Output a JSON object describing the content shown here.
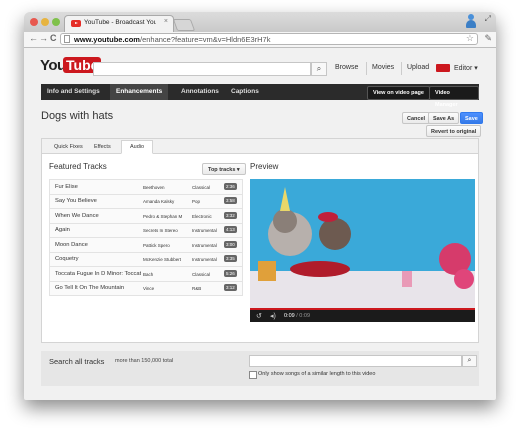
{
  "browser": {
    "tab_title": "YouTube - Broadcast Yoursel",
    "tab_close": "×",
    "url_host": "www.youtube.com",
    "url_path": "/enhance?feature=vm&v=Hldn6E3rH7k",
    "back": "←",
    "forward": "→",
    "reload": "C"
  },
  "youtube": {
    "logo_you": "You",
    "logo_tube": "Tube",
    "header_links": [
      "Browse",
      "Movies",
      "Upload"
    ],
    "user": "Editor ▾"
  },
  "nav": {
    "items": [
      "Info and Settings",
      "Enhancements",
      "Annotations",
      "Captions"
    ],
    "active_index": 1,
    "right_buttons": [
      "View on video page",
      "Video Manager"
    ]
  },
  "video_title": "Dogs with hats",
  "actions": {
    "cancel": "Cancel",
    "save_as": "Save As",
    "save": "Save",
    "revert": "Revert to original"
  },
  "subtabs": [
    "Quick Fixes",
    "Effects",
    "Audio"
  ],
  "active_subtab": 2,
  "featured": {
    "title": "Featured Tracks",
    "sort_label": "Top tracks ▾",
    "tracks": [
      {
        "title": "Fur Elise",
        "artist": "Beethoven",
        "genre": "Classical",
        "duration": "2:36"
      },
      {
        "title": "Say You Believe",
        "artist": "Amanda Kalsky",
        "genre": "Pop",
        "duration": "3:58"
      },
      {
        "title": "When We Dance",
        "artist": "Pedro & Stephan M",
        "genre": "Electronic",
        "duration": "3:32"
      },
      {
        "title": "Again",
        "artist": "Secrets In Stereo",
        "genre": "Instrumental",
        "duration": "4:13"
      },
      {
        "title": "Moon Dance",
        "artist": "Pattick Spero",
        "genre": "Instrumental",
        "duration": "3:00"
      },
      {
        "title": "Coquetry",
        "artist": "McKenzie Stubbert",
        "genre": "Instrumental",
        "duration": "3:35"
      },
      {
        "title": "Toccata Fugue In D Minor: Toccata",
        "artist": "Bach",
        "genre": "Classical",
        "duration": "5:26"
      },
      {
        "title": "Go Tell It On The Mountain",
        "artist": "Vince",
        "genre": "R&B",
        "duration": "3:12"
      }
    ]
  },
  "preview": {
    "title": "Preview",
    "time_current": "0:09",
    "time_total": "/ 0:09",
    "progress": 1.0
  },
  "search": {
    "title": "Search all tracks",
    "subtitle": "more than 150,000 total",
    "placeholder": "",
    "checkbox_label": "Only show songs of a similar length to this video",
    "checked": false
  },
  "colors": {
    "brand_red": "#cc181e",
    "nav_bg": "#2b2b2b",
    "save_blue": "#4d90fe"
  },
  "icons": [
    "search-icon",
    "star-icon",
    "wrench-icon",
    "replay-icon",
    "volume-icon"
  ]
}
